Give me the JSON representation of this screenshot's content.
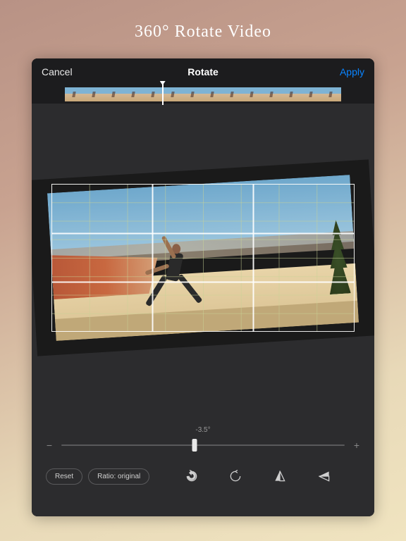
{
  "promo": {
    "title": "360° Rotate Video"
  },
  "nav": {
    "cancel": "Cancel",
    "title": "Rotate",
    "apply": "Apply"
  },
  "controls": {
    "angle_label": "-3.5°",
    "slider_min": "−",
    "slider_max": "+",
    "reset": "Reset",
    "ratio": "Ratio: original"
  },
  "thumbnails": {
    "count": 14
  }
}
